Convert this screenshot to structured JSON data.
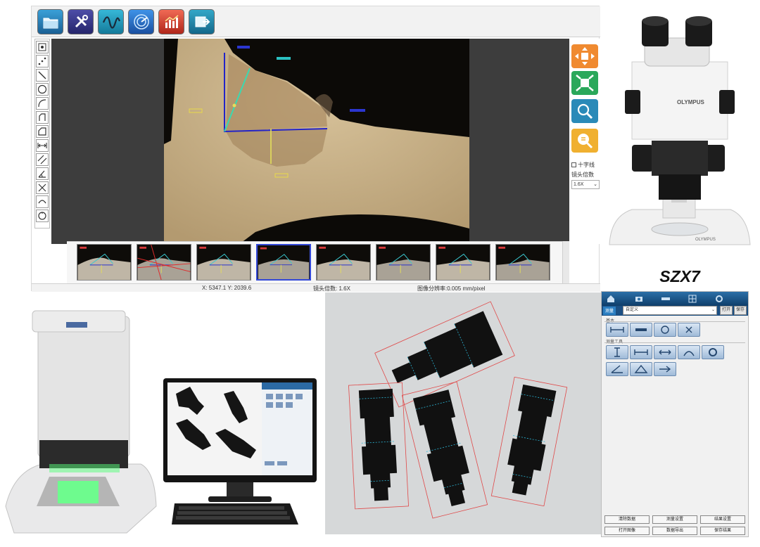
{
  "weld_app": {
    "toolbar": [
      {
        "name": "open-folder-icon",
        "color": "#2f8ec9"
      },
      {
        "name": "tools-icon",
        "color": "#3b3b8e"
      },
      {
        "name": "waveform-icon",
        "color": "#2aa6c8"
      },
      {
        "name": "radar-icon",
        "color": "#2b7fd6"
      },
      {
        "name": "chart-icon",
        "color": "#d84a3a"
      },
      {
        "name": "export-icon",
        "color": "#2a8fb0"
      }
    ],
    "left_tools": [
      "select-tool-icon",
      "point-tool-icon",
      "line-tool-icon",
      "circle-tool-icon",
      "arc-tool-icon",
      "polyline-tool-icon",
      "polygon-tool-icon",
      "distance-tool-icon",
      "parallel-tool-icon",
      "angle-tool-icon",
      "cross-tool-icon",
      "curve-tool-icon",
      "round-tool-icon"
    ],
    "right_panel": {
      "buttons": [
        "move-icon",
        "fit-icon",
        "zoom-icon",
        "search-icon"
      ],
      "checkbox_label": "十字线",
      "zoom_label": "镜头倍数",
      "zoom_value": "1.6X"
    },
    "thumbnail_count": 8,
    "selected_thumbnail": 4,
    "status": {
      "coords": "X: 5347.1 Y: 2039.6",
      "magnification": "镜头倍数: 1.6X",
      "pixel_scale": "图像分辨率:0.005 mm/pixel"
    }
  },
  "microscope": {
    "brand": "OLYMPUS",
    "model": "SZX7"
  },
  "meas_app": {
    "tabs": [
      "测量"
    ],
    "dropdown_value": "自定义",
    "btn_a": "打开",
    "btn_b": "保存",
    "section_1": "基本",
    "section_2": "测量工具",
    "footer_buttons": [
      "清除数据",
      "测量设置",
      "结果设置",
      "打开图像",
      "数据导出",
      "保存结果"
    ]
  }
}
